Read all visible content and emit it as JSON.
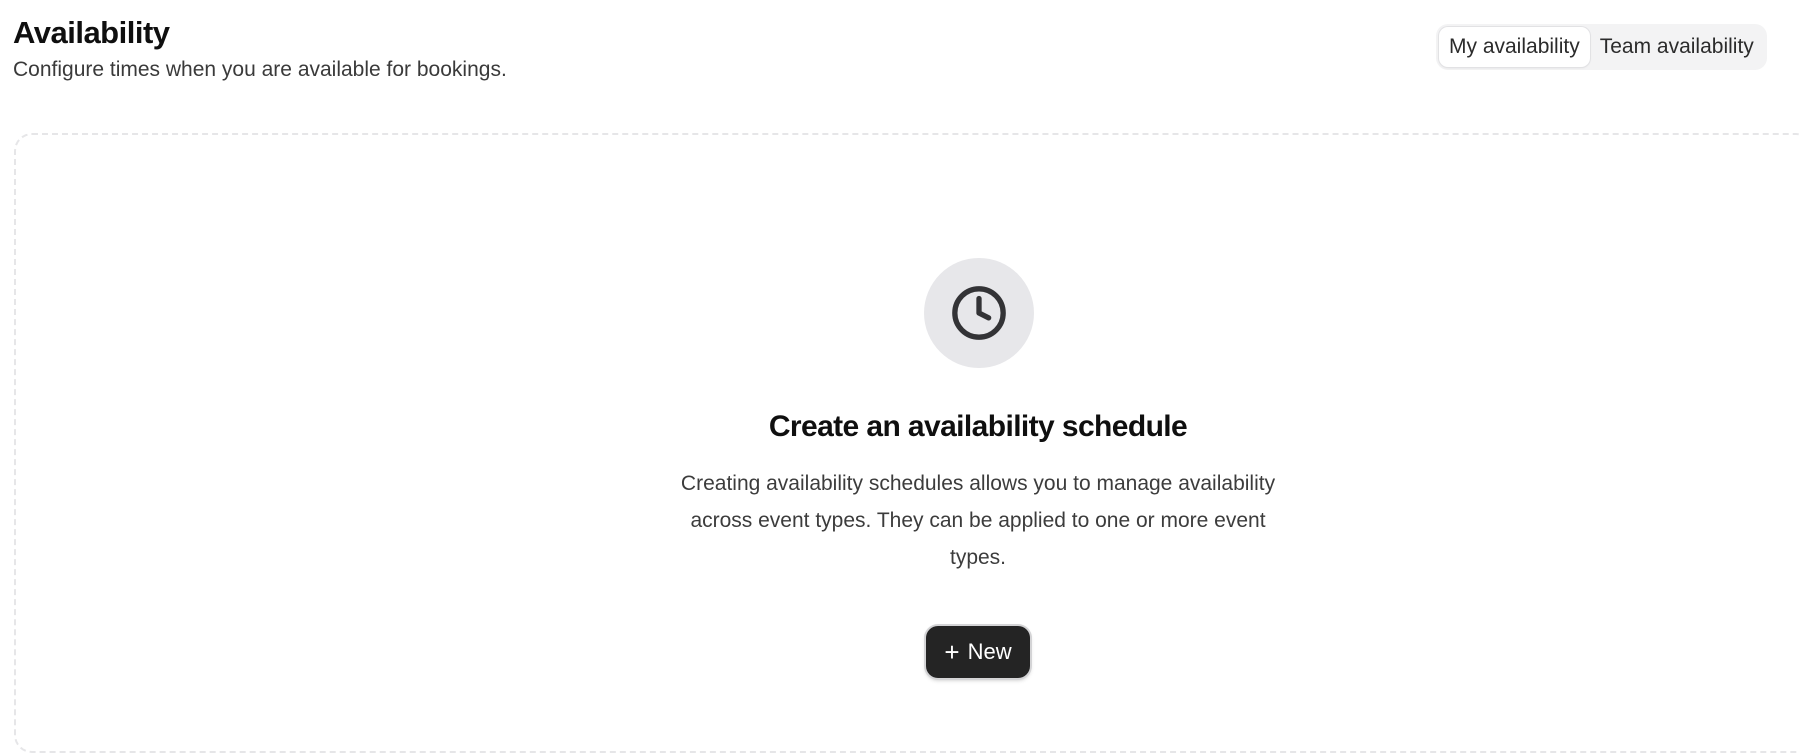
{
  "header": {
    "title": "Availability",
    "subtitle": "Configure times when you are available for bookings."
  },
  "toggle": {
    "options": [
      {
        "label": "My availability",
        "active": true
      },
      {
        "label": "Team availability",
        "active": false
      }
    ]
  },
  "empty_state": {
    "icon": "clock-icon",
    "title": "Create an availability schedule",
    "description": "Creating availability schedules allows you to manage availability across event types. They can be applied to one or more event types.",
    "button": {
      "icon": "plus-icon",
      "icon_glyph": "+",
      "label": "New"
    }
  },
  "colors": {
    "primary_button": "#242424",
    "icon_circle": "#e7e7ea",
    "panel_border": "#e6e6e8"
  }
}
